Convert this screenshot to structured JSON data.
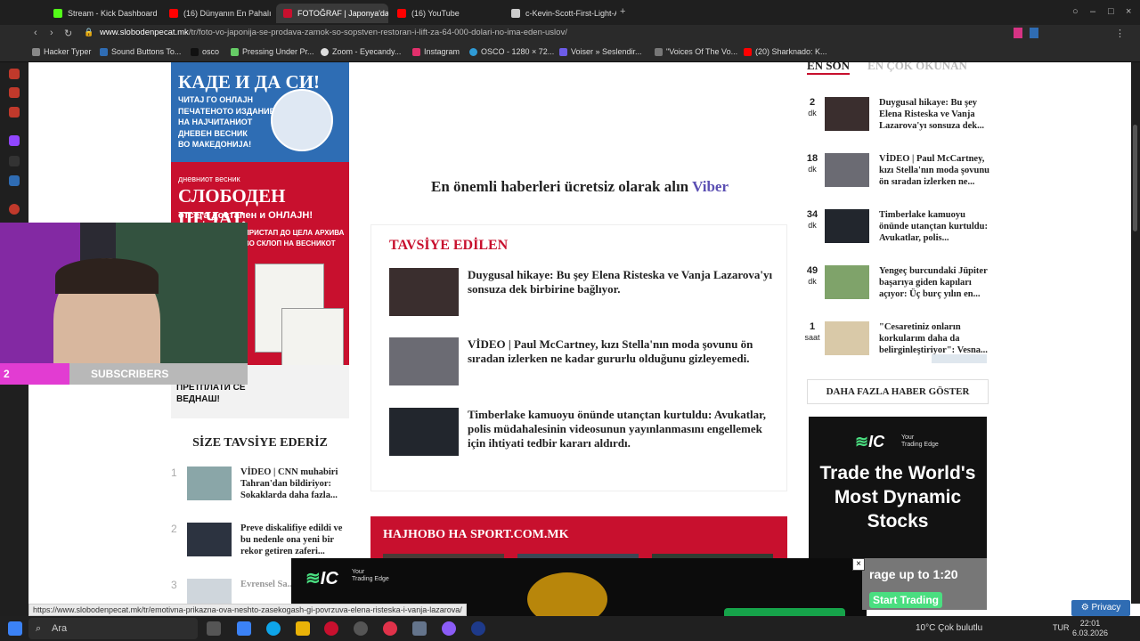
{
  "browser": {
    "tabs": [
      {
        "label": "Stream - Kick Dashboard",
        "color": "#53fc18"
      },
      {
        "label": "(16) Dünyanın En Pahalı Ev",
        "color": "#ff0000"
      },
      {
        "label": "FOTOĞRAF | Japonya'da",
        "color": "#c8102e"
      },
      {
        "label": "(16) YouTube",
        "color": "#ff0000"
      },
      {
        "label": "c-Kevin-Scott-First-Light-A",
        "color": "#cccccc"
      }
    ],
    "url_domain": "www.slobodenpecat.mk",
    "url_path": "/tr/foto-vo-japonija-se-prodava-zamok-so-sopstven-restoran-i-lift-za-64-000-dolari-no-ima-eden-uslov/",
    "bookmarks": [
      "Hacker Typer",
      "Sound Buttons To...",
      "osco",
      "Pressing Under Pr...",
      "Zoom - Eyecandy...",
      "Instagram",
      "OSCO - 1280 × 72...",
      "Voiser » Seslendir...",
      "\"Voices Of The Vo...",
      "(20) Sharknado: K..."
    ]
  },
  "ad_left": {
    "headline": "КАДЕ И ДА СИ!",
    "lines": [
      "ЧИТАЈ ГО ОНЛАЈН",
      "ПЕЧАТЕНОТО ИЗДАНИЕ",
      "НА НАЈЧИТАНИОТ",
      "ДНЕВЕН ВЕСНИК",
      "ВО МАКЕДОНИЈА!"
    ],
    "sub": "дневниот весник",
    "brand": "СЛОБОДЕН ПЕЧАТ.",
    "tagline": "отсега достапен и ОНЛАЈН!",
    "access": "ПРИСТАП ДО ЦЕЛА АРХИВА",
    "archive": "ВО СКЛОП НА ВЕСНИКОТ",
    "cta": "КЛИКНИ ТУКА И ПРЕТПЛАТИ СЕ ВЕДНАШ!"
  },
  "viber": {
    "text": "En önemli haberleri ücretsiz olarak alın",
    "link": "Viber"
  },
  "recommended": {
    "title": "TAVSİYE EDİLEN",
    "items": [
      {
        "title": "Duygusal hikaye: Bu şey Elena Risteska ve Vanja Lazarova'yı sonsuza dek birbirine bağlıyor."
      },
      {
        "title": "VİDEO | Paul McCartney, kızı Stella'nın moda şovunu ön sıradan izlerken ne kadar gururlu olduğunu gizleyemedi."
      },
      {
        "title": "Timberlake kamuoyu önünde utançtan kurtuldu: Avukatlar, polis müdahalesinin videosunun yayınlanmasını engellemek için ihtiyati tedbir kararı aldırdı."
      }
    ]
  },
  "sport": {
    "title": "НАЈНОВО НА SPORT.COM.MK"
  },
  "suggest": {
    "title": "SİZE TAVSİYE EDERİZ",
    "items": [
      {
        "num": "1",
        "title": "VİDEO | CNN muhabiri Tahran'dan bildiriyor: Sokaklarda daha fazla..."
      },
      {
        "num": "2",
        "title": "Preve diskalifiye edildi ve bu nedenle ona yeni bir rekor getiren zaferi..."
      },
      {
        "num": "3",
        "title": "Evrensel Sa... için ilgili ta..."
      }
    ]
  },
  "right": {
    "tab_latest": "EN SON",
    "tab_popular": "EN ÇOK OKUNAN",
    "items": [
      {
        "num": "2",
        "unit": "dk",
        "title": "Duygusal hikaye: Bu şey Elena Risteska ve Vanja Lazarova'yı sonsuza dek..."
      },
      {
        "num": "18",
        "unit": "dk",
        "title": "VİDEO | Paul McCartney, kızı Stella'nın moda şovunu ön sıradan izlerken ne..."
      },
      {
        "num": "34",
        "unit": "dk",
        "title": "Timberlake kamuoyu önünde utançtan kurtuldu: Avukatlar, polis..."
      },
      {
        "num": "49",
        "unit": "dk",
        "title": "Yengeç burcundaki Jüpiter başarıya giden kapıları açıyor: Üç burç yılın en..."
      },
      {
        "num": "1",
        "unit": "saat",
        "title": "\"Cesaretiniz onların korkularım daha da belirginleştiriyor\": Vesna..."
      }
    ],
    "more": "DAHA FAZLA HABER GÖSTER"
  },
  "ad_right": {
    "logo": "IC",
    "tag_line1": "Your",
    "tag_line2": "Trading Edge",
    "headline": "Trade the World's Most Dynamic Stocks"
  },
  "ad_bottom": {
    "logo": "IC",
    "tag_line1": "Your",
    "tag_line2": "Trading Edge",
    "close": "×",
    "rest_line1": "rage up to 1:20",
    "rest_line2": "Start Trading"
  },
  "privacy": "Privacy",
  "status_url": "https://www.slobodenpecat.mk/tr/emotivna-prikazna-ova-neshto-zasekogash-gi-povrzuva-elena-risteska-i-vanja-lazarova/",
  "webcam": {
    "count": "2",
    "subs": "SUBSCRIBERS"
  },
  "taskbar": {
    "search": "Ara",
    "weather": "10°C  Çok bulutlu",
    "lang": "TUR",
    "time": "22:01",
    "date": "6.03.2026"
  }
}
